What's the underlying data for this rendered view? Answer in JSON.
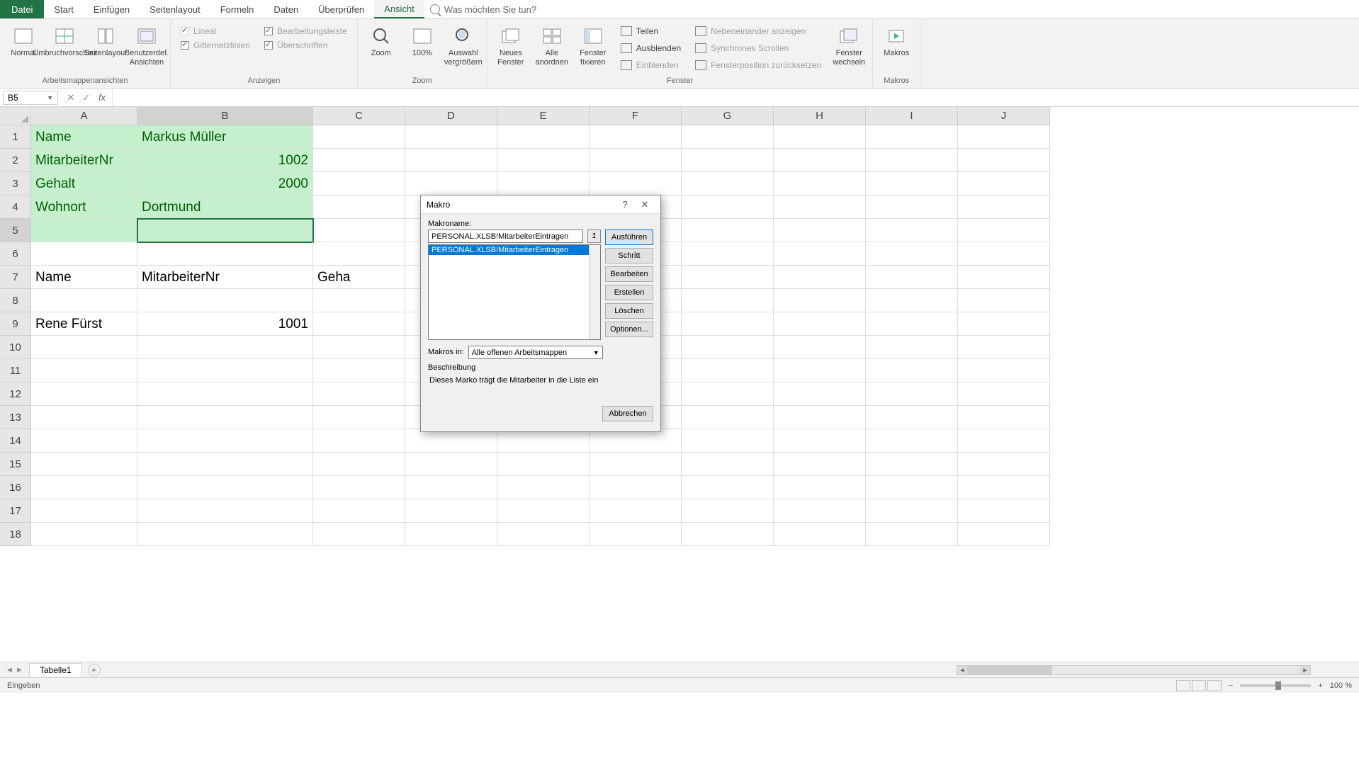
{
  "tabs": {
    "file": "Datei",
    "list": [
      "Start",
      "Einfügen",
      "Seitenlayout",
      "Formeln",
      "Daten",
      "Überprüfen",
      "Ansicht"
    ],
    "active": "Ansicht",
    "search_placeholder": "Was möchten Sie tun?"
  },
  "ribbon": {
    "views": {
      "normal": "Normal",
      "pagebreak": "Umbruchvorschau",
      "pagelayout": "Seitenlayout",
      "custom": "Benutzerdef. Ansichten",
      "label": "Arbeitsmappenansichten"
    },
    "show": {
      "ruler": "Lineal",
      "formula_bar": "Bearbeitungsleiste",
      "gridlines": "Gitternetzlinien",
      "headings": "Überschriften",
      "label": "Anzeigen"
    },
    "zoom": {
      "zoom": "Zoom",
      "hundred": "100%",
      "selection": "Auswahl vergrößern",
      "label": "Zoom"
    },
    "window": {
      "new": "Neues Fenster",
      "arrange": "Alle anordnen",
      "freeze": "Fenster fixieren",
      "split": "Teilen",
      "hide": "Ausblenden",
      "unhide": "Einblenden",
      "side": "Nebeneinander anzeigen",
      "sync": "Synchrones Scrollen",
      "reset": "Fensterposition zurücksetzen",
      "switch": "Fenster wechseln",
      "label": "Fenster"
    },
    "macros": {
      "macros": "Makros",
      "label": "Makros"
    }
  },
  "name_box": "B5",
  "columns": [
    "A",
    "B",
    "C",
    "D",
    "E",
    "F",
    "G",
    "H",
    "I",
    "J"
  ],
  "rows_shown": 18,
  "cells": {
    "A1": "Name",
    "B1": "Markus Müller",
    "A2": "MitarbeiterNr",
    "B2": "1002",
    "A3": "Gehalt",
    "B3": "2000",
    "A4": "Wohnort",
    "B4": "Dortmund",
    "A7": "Name",
    "B7": "MitarbeiterNr",
    "C7": "Geha",
    "A9": "Rene Fürst",
    "B9": "1001"
  },
  "sheet": {
    "tab": "Tabelle1"
  },
  "status": {
    "mode": "Eingeben",
    "zoom": "100 %"
  },
  "dialog": {
    "title": "Makro",
    "name_label": "Makroname:",
    "name_value": "PERSONAL.XLSB!MitarbeiterEintragen",
    "list_item": "PERSONAL.XLSB!MitarbeiterEintragen",
    "buttons": {
      "run": "Ausführen",
      "step": "Schritt",
      "edit": "Bearbeiten",
      "create": "Erstellen",
      "delete": "Löschen",
      "options": "Optionen..."
    },
    "macros_in_label": "Makros in:",
    "macros_in_value": "Alle offenen Arbeitsmappen",
    "desc_label": "Beschreibung",
    "desc_text": "Dieses Marko trägt die Mitarbeiter in die Liste ein",
    "cancel": "Abbrechen"
  }
}
